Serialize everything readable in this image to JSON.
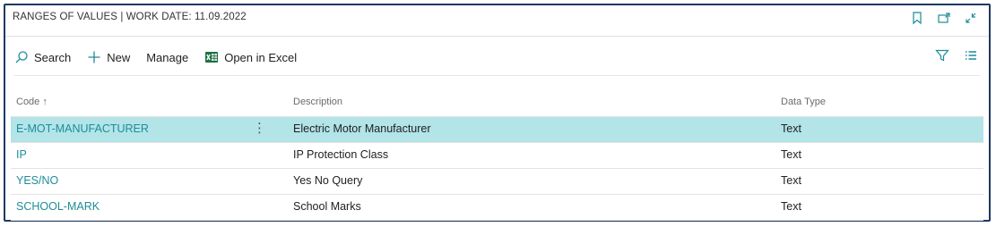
{
  "window": {
    "title": "RANGES OF VALUES | WORK DATE: 11.09.2022",
    "icons": [
      "bookmark-icon",
      "open-new-window-icon",
      "collapse-icon"
    ]
  },
  "actions": {
    "search_label": "Search",
    "new_label": "New",
    "manage_label": "Manage",
    "excel_label": "Open in Excel",
    "right_icons": [
      "filter-icon",
      "list-view-icon"
    ]
  },
  "table": {
    "headers": {
      "code": "Code ↑",
      "description": "Description",
      "data_type": "Data Type"
    },
    "rows": [
      {
        "code": "E-MOT-MANUFACTURER",
        "description": "Electric Motor Manufacturer",
        "data_type": "Text",
        "selected": true
      },
      {
        "code": "IP",
        "description": "IP Protection Class",
        "data_type": "Text",
        "selected": false
      },
      {
        "code": "YES/NO",
        "description": "Yes No Query",
        "data_type": "Text",
        "selected": false
      },
      {
        "code": "SCHOOL-MARK",
        "description": "School Marks",
        "data_type": "Text",
        "selected": false
      }
    ],
    "row_menu_glyph": "⋮"
  },
  "colors": {
    "frame_border": "#1f3864",
    "selected_row": "#b2e4e8",
    "link": "#1e8c98",
    "excel_green": "#1d6f42",
    "icon_blue": "#1e8c98"
  }
}
